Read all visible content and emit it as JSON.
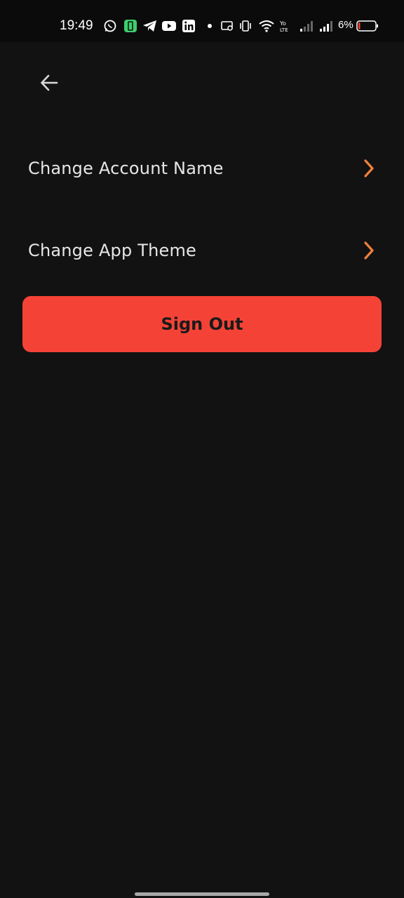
{
  "status_bar": {
    "time": "19:49",
    "battery_percent": "6%",
    "icons": [
      "whatsapp-icon",
      "battery-saver-icon",
      "telegram-icon",
      "youtube-icon",
      "linkedin-icon",
      "notification-dot-icon",
      "cast-icon",
      "vibrate-icon",
      "wifi-icon",
      "volte-icon",
      "signal-1-icon",
      "signal-2-icon",
      "battery-icon"
    ]
  },
  "header": {
    "back_icon": "arrow-left-icon"
  },
  "settings": {
    "items": [
      {
        "label": "Change Account Name",
        "icon": "chevron-right-icon"
      },
      {
        "label": "Change App Theme",
        "icon": "chevron-right-icon"
      }
    ],
    "sign_out_label": "Sign Out"
  },
  "colors": {
    "background": "#121212",
    "accent": "#f0803c",
    "danger": "#f44336"
  }
}
